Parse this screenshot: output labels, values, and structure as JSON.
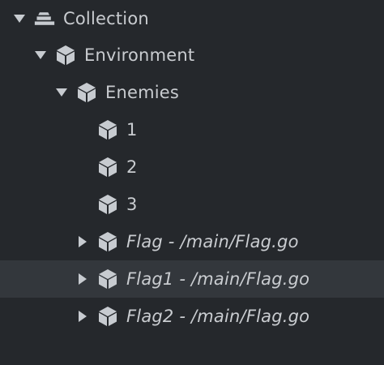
{
  "colors": {
    "background": "#25282c",
    "selected_row": "#33373c",
    "text": "#c9ccd0",
    "icon": "#c7cbd0"
  },
  "tree": {
    "collection": {
      "label": "Collection",
      "icon": "collection-icon",
      "state": "expanded"
    },
    "environment": {
      "label": "Environment",
      "icon": "game-object-icon",
      "state": "expanded"
    },
    "enemies": {
      "label": "Enemies",
      "icon": "game-object-icon",
      "state": "expanded"
    },
    "item_1": {
      "label": "1",
      "icon": "game-object-icon"
    },
    "item_2": {
      "label": "2",
      "icon": "game-object-icon"
    },
    "item_3": {
      "label": "3",
      "icon": "game-object-icon"
    },
    "flag": {
      "label": "Flag - /main/Flag.go",
      "icon": "game-object-icon",
      "state": "collapsed"
    },
    "flag1": {
      "label": "Flag1 - /main/Flag.go",
      "icon": "game-object-icon",
      "state": "collapsed",
      "selected": true
    },
    "flag2": {
      "label": "Flag2 - /main/Flag.go",
      "icon": "game-object-icon",
      "state": "collapsed"
    }
  }
}
